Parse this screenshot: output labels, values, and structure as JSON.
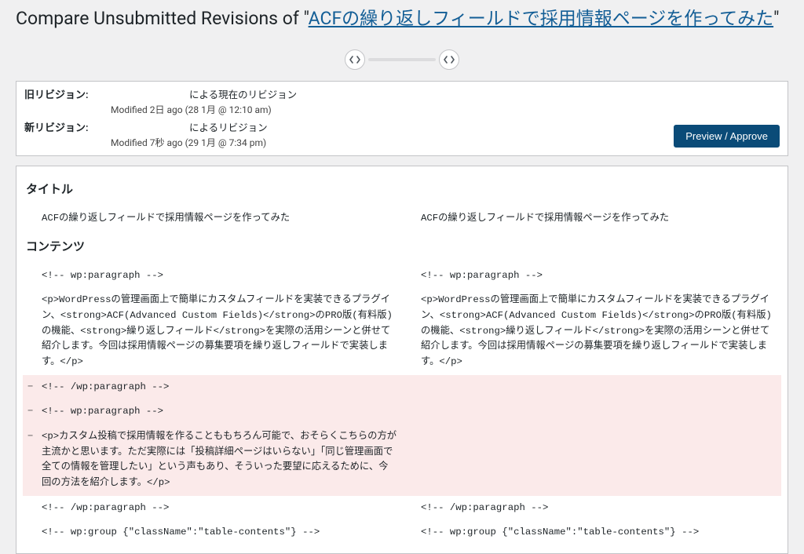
{
  "header": {
    "prefix": "Compare Unsubmitted Revisions of \"",
    "link_text": "ACFの繰り返しフィールドで採用情報ページを作ってみた",
    "suffix": "\""
  },
  "slider": {
    "prev_icon": "‹›",
    "next_icon": "‹›"
  },
  "meta": {
    "old_label": "旧リビジョン:",
    "old_title": " による現在のリビジョン",
    "old_sub": "Modified 2日 ago (28 1月 @ 12:10 am)",
    "new_label": "新リビジョン:",
    "new_title": " によるリビジョン",
    "new_sub": "Modified 7秒 ago (29 1月 @ 7:34 pm)",
    "approve": "Preview / Approve"
  },
  "sections": {
    "title_heading": "タイトル",
    "content_heading": "コンテンツ"
  },
  "title_row": {
    "left": "ACFの繰り返しフィールドで採用情報ページを作ってみた",
    "right": "ACFの繰り返しフィールドで採用情報ページを作ってみた"
  },
  "content_rows": [
    {
      "type": "ctx",
      "left": "<!-- wp:paragraph -->",
      "right": "<!-- wp:paragraph -->"
    },
    {
      "type": "ctx",
      "left": "<p>WordPressの管理画面上で簡単にカスタムフィールドを実装できるプラグイン、<strong>ACF(Advanced Custom Fields)</strong>のPRO版(有料版)の機能、<strong>繰り返しフィールド</strong>を実際の活用シーンと併せて紹介します。今回は採用情報ページの募集要項を繰り返しフィールドで実装します。</p>",
      "right": "<p>WordPressの管理画面上で簡単にカスタムフィールドを実装できるプラグイン、<strong>ACF(Advanced Custom Fields)</strong>のPRO版(有料版)の機能、<strong>繰り返しフィールド</strong>を実際の活用シーンと併せて紹介します。今回は採用情報ページの募集要項を繰り返しフィールドで実装します。</p>"
    },
    {
      "type": "del",
      "left": "<!-- /wp:paragraph -->",
      "right": ""
    },
    {
      "type": "del",
      "left": "<!-- wp:paragraph -->",
      "right": ""
    },
    {
      "type": "del",
      "left": "<p>カスタム投稿で採用情報を作ることももちろん可能で、おそらくこちらの方が主流かと思います。ただ実際には「投稿詳細ページはいらない」「同じ管理画面で全ての情報を管理したい」という声もあり、そういった要望に応えるために、今回の方法を紹介します。</p>",
      "right": ""
    },
    {
      "type": "ctx",
      "left": "<!-- /wp:paragraph -->",
      "right": "<!-- /wp:paragraph -->"
    },
    {
      "type": "ctx",
      "left": "<!-- wp:group {\"className\":\"table-contents\"} -->",
      "right": "<!-- wp:group {\"className\":\"table-contents\"} -->"
    }
  ],
  "minus": "−"
}
